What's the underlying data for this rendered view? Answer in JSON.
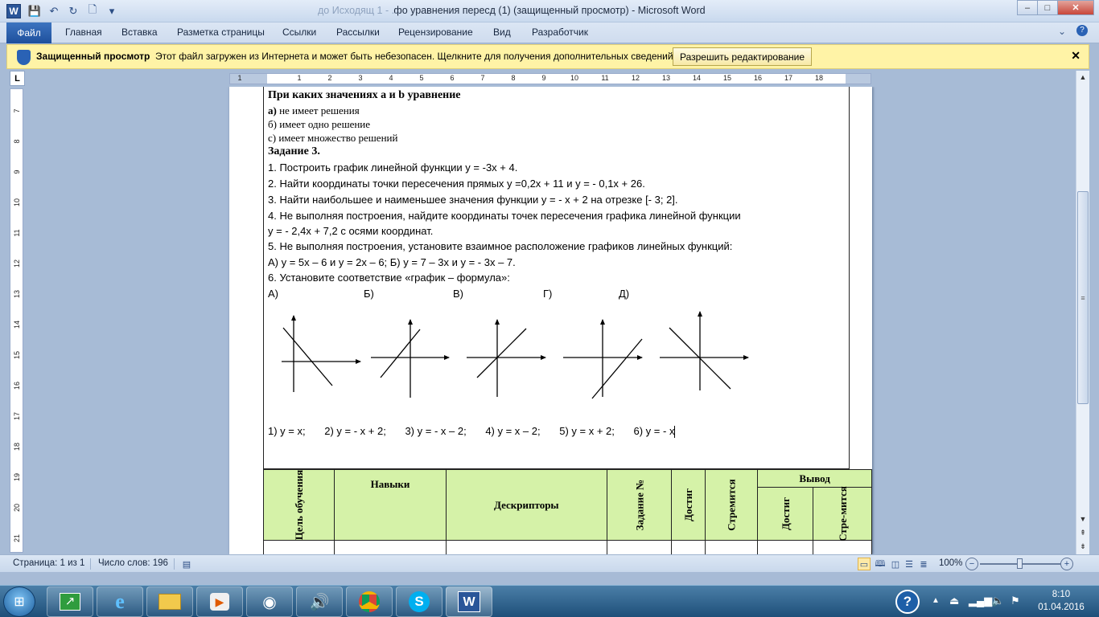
{
  "window": {
    "title": "фо уравнения пересд (1) (защищенный просмотр)  -  Microsoft Word",
    "faded_title": "до Исходящ 1 - ...",
    "minimize": "–",
    "maximize": "□",
    "close": "✕"
  },
  "ribbon": {
    "file_tab": "Файл",
    "tabs": [
      "Главная",
      "Вставка",
      "Разметка страницы",
      "Ссылки",
      "Рассылки",
      "Рецензирование",
      "Вид",
      "Разработчик"
    ]
  },
  "protected_view": {
    "title": "Защищенный просмотр",
    "message": "Этот файл загружен из Интернета и может быть небезопасен. Щелкните для получения дополнительных сведений.",
    "button": "Разрешить редактирование",
    "close": "✕"
  },
  "ruler": {
    "corner": "L",
    "h_numbers": [
      "1",
      "1",
      "2",
      "3",
      "4",
      "5",
      "6",
      "7",
      "8",
      "9",
      "10",
      "11",
      "12",
      "13",
      "14",
      "15",
      "16",
      "17",
      "18"
    ],
    "v_numbers": [
      "7",
      "8",
      "9",
      "10",
      "11",
      "12",
      "13",
      "14",
      "15",
      "16",
      "17",
      "18",
      "19",
      "20",
      "21"
    ]
  },
  "document": {
    "heading": "При каких значениях a и b уравнение",
    "opt_a_letter": "а)",
    "opt_a_text": " не имеет решения",
    "opt_b": "б) имеет одно решение",
    "opt_c": "с) имеет множество решений",
    "task3": "Задание 3.",
    "items": [
      "1. Построить график линейной функции y = -3x + 4.",
      "2. Найти координаты точки пересечения прямых y =0,2x + 11 и y = - 0,1x + 26.",
      "3. Найти наибольшее и наименьшее значения функции y = - x + 2 на отрезке  [- 3; 2].",
      "4. Не выполняя построения, найдите координаты точек пересечения графика линейной функции",
      "y = - 2,4x + 7,2 с осями координат.",
      "5. Не выполняя построения, установите взаимное расположение графиков линейных функций:",
      "А) y = 5x – 6 и y = 2x – 6;   Б) y = 7 – 3x и y = - 3x – 7.",
      "6. Установите соответствие «график – формула»:"
    ],
    "graph_labels": [
      "А)",
      "Б)",
      "В)",
      "Г)",
      "Д)"
    ],
    "formulas": [
      "1) y = x;",
      "2) y = - x + 2;",
      "3) y = - x – 2;",
      "4) y = x – 2;",
      "5) y = x + 2;",
      "6) y = - x"
    ]
  },
  "assessment_table": {
    "goal": "Цель обучения",
    "skills": "Навыки",
    "descriptors": "Дескрипторы",
    "task_no": "Задание №",
    "achieved": "Достиг",
    "striving": "Стремится",
    "conclusion": "Вывод",
    "conclusion_achieved": "Достиг",
    "conclusion_striving": "Стре-мится"
  },
  "status_bar": {
    "page": "Страница: 1 из 1",
    "words": "Число слов: 196",
    "zoom": "100%",
    "zoom_level_percent": 100
  },
  "taskbar": {
    "start": "⊞",
    "apps": [
      "media-center",
      "internet-explorer",
      "file-explorer",
      "media-player",
      "wifi-manager",
      "volume-app",
      "chrome",
      "skype",
      "word"
    ],
    "clock_time": "8:10",
    "clock_date": "01.04.2016"
  }
}
